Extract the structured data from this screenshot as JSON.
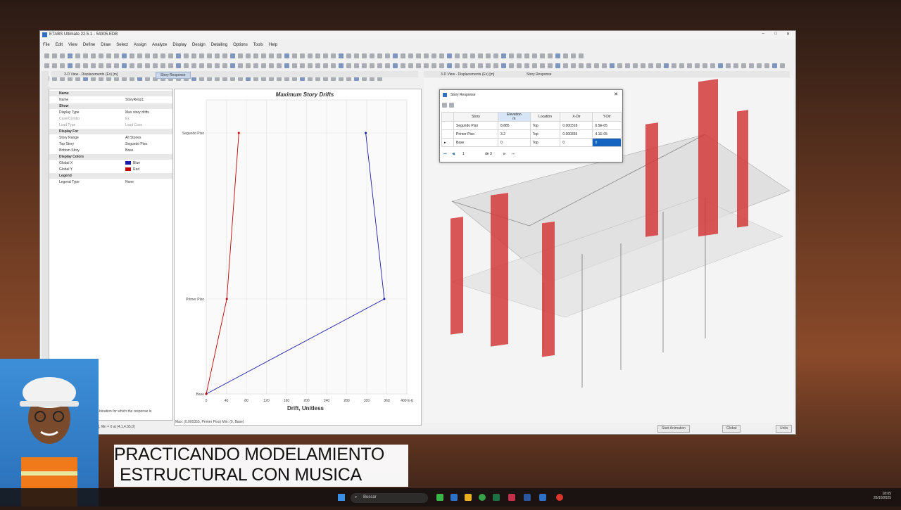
{
  "window": {
    "title": "ETABS Ultimate 22.5.1 - 54305.EDB",
    "min": "–",
    "max": "□",
    "close": "✕"
  },
  "menu": [
    "File",
    "Edit",
    "View",
    "Define",
    "Draw",
    "Select",
    "Assign",
    "Analyze",
    "Display",
    "Design",
    "Detailing",
    "Options",
    "Tools",
    "Help"
  ],
  "left_tabs": {
    "tab1": "3-D View - Displacements (Ex) [m]",
    "tab2": "Story Response"
  },
  "right_tabs": {
    "tab1": "3-D View - Displacements (Ex) [m]",
    "tab2": "Story Response"
  },
  "properties": {
    "rows": [
      {
        "k": "Name",
        "v": "",
        "hdr": true
      },
      {
        "k": "Name",
        "v": "StoryResp1"
      },
      {
        "k": "Show",
        "v": "",
        "hdr": true
      },
      {
        "k": "Display Type",
        "v": "Max story drifts"
      },
      {
        "k": "Case/Combo",
        "v": "Ex",
        "dim": true
      },
      {
        "k": "Load Type",
        "v": "Load Case",
        "dim": true
      },
      {
        "k": "Display For",
        "v": "",
        "hdr": true
      },
      {
        "k": "Story Range",
        "v": "All Stories"
      },
      {
        "k": "Top Story",
        "v": "Segundo Piso"
      },
      {
        "k": "Bottom Story",
        "v": "Base"
      },
      {
        "k": "Display Colors",
        "v": "",
        "hdr": true
      },
      {
        "k": "Global X",
        "v": "Blue",
        "swatch": "#1a1aa8"
      },
      {
        "k": "Global Y",
        "v": "Red",
        "swatch": "#c00000"
      },
      {
        "k": "Legend",
        "v": "",
        "hdr": true
      },
      {
        "k": "Legend Type",
        "v": "None"
      }
    ]
  },
  "status_left": "...bination for which the response is",
  "status_left2": "1], Mn = 0 at [4.1,4.55,0]",
  "status_mid": "Max: (0.000355, Primer Piso)   Min: (0, Base)",
  "status_right": {
    "anim": "Start Animation",
    "global": "Global",
    "units": "Units"
  },
  "chart_data": {
    "type": "line",
    "title": "Maximum Story Drifts",
    "xlabel": "Drift, Unitless",
    "ylabel": "",
    "x_ticks": [
      "0",
      "40",
      "80",
      "120",
      "160",
      "200",
      "240",
      "280",
      "320",
      "360",
      "400 E-6"
    ],
    "xlim": [
      0,
      400
    ],
    "y_levels": [
      "Base",
      "Primer Piso",
      "Segundo Piso"
    ],
    "series": [
      {
        "name": "Global X",
        "color": "#1a1aa8",
        "x": [
          0,
          355,
          318
        ],
        "y": [
          "Base",
          "Primer Piso",
          "Segundo Piso"
        ]
      },
      {
        "name": "Global Y",
        "color": "#c00000",
        "x": [
          0,
          41,
          65
        ],
        "y": [
          "Base",
          "Primer Piso",
          "Segundo Piso"
        ]
      }
    ]
  },
  "dialog": {
    "title": "Story Response",
    "columns": [
      "Story",
      "Elevation\nm",
      "Location",
      "X-Dir",
      "Y-Dir"
    ],
    "rows": [
      [
        "Segundo Piso",
        "8.885",
        "Top",
        "0.000318",
        "6.5E-05"
      ],
      [
        "Primer Piso",
        "3.2",
        "Top",
        "0.000355",
        "4.1E-05"
      ],
      [
        "Base",
        "0",
        "Top",
        "0",
        "0"
      ]
    ],
    "nav": {
      "page": "1",
      "of": "de 3"
    }
  },
  "caption": {
    "line1": "PRACTICANDO MODELAMIENTO",
    "line2": "ESTRUCTURAL CON MUSICA"
  },
  "taskbar": {
    "search": "Buscar",
    "time": "18:05",
    "date": "26/10/2025"
  },
  "colors": {
    "accent": "#1565c0",
    "column_red": "#d23a3a"
  }
}
